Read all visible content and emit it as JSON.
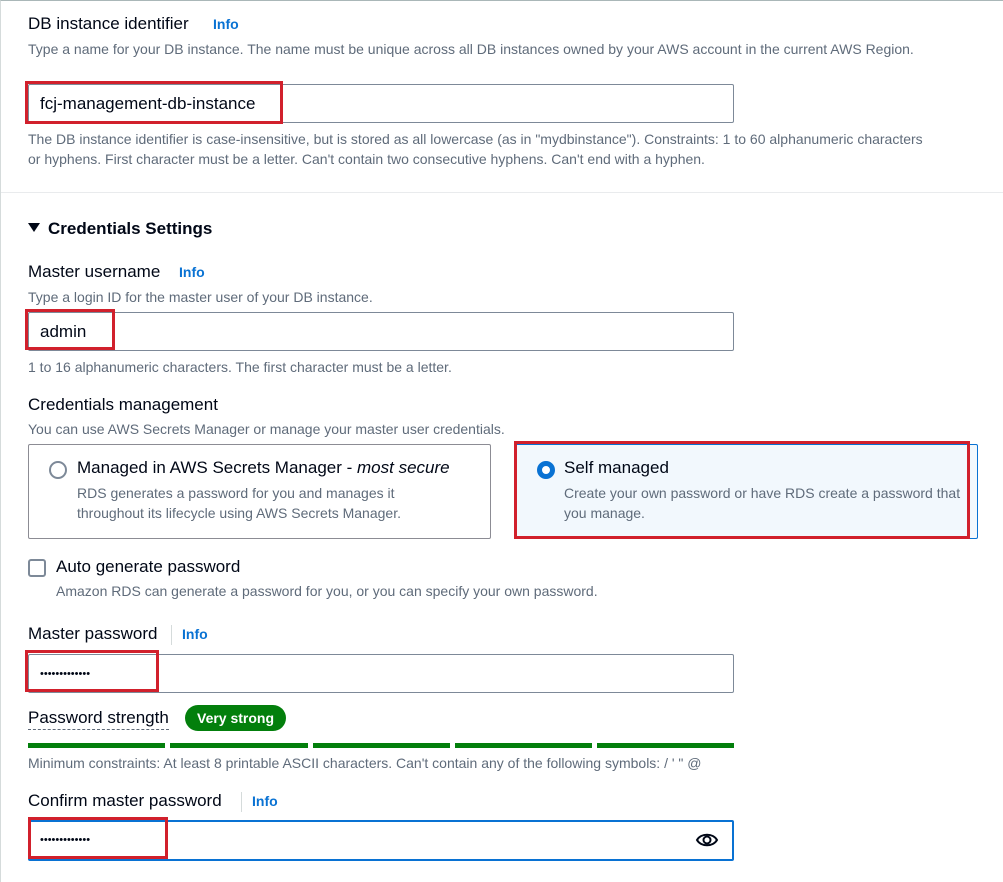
{
  "instance": {
    "label": "DB instance identifier",
    "info": "Info",
    "description": "Type a name for your DB instance. The name must be unique across all DB instances owned by your AWS account in the current AWS Region.",
    "value": "fcj-management-db-instance",
    "hint": "The DB instance identifier is case-insensitive, but is stored as all lowercase (as in \"mydbinstance\"). Constraints: 1 to 60 alphanumeric characters or hyphens. First character must be a letter. Can't contain two consecutive hyphens. Can't end with a hyphen."
  },
  "credentials": {
    "heading": "Credentials Settings",
    "username": {
      "label": "Master username",
      "info": "Info",
      "description": "Type a login ID for the master user of your DB instance.",
      "value": "admin",
      "hint": "1 to 16 alphanumeric characters. The first character must be a letter."
    },
    "management": {
      "label": "Credentials management",
      "description": "You can use AWS Secrets Manager or manage your master user credentials.",
      "options": [
        {
          "title": "Managed in AWS Secrets Manager - ",
          "title_em": "most secure",
          "description": "RDS generates a password for you and manages it throughout its lifecycle using AWS Secrets Manager.",
          "selected": false
        },
        {
          "title": "Self managed",
          "title_em": "",
          "description": "Create your own password or have RDS create a password that you manage.",
          "selected": true
        }
      ]
    },
    "auto_generate": {
      "label": "Auto generate password",
      "description": "Amazon RDS can generate a password for you, or you can specify your own password.",
      "checked": false
    },
    "password": {
      "label": "Master password",
      "info": "Info",
      "value": "•••••••••••••",
      "strength_label": "Password strength",
      "strength_value": "Very strong",
      "strength_fraction": 1.0,
      "constraints": "Minimum constraints: At least 8 printable ASCII characters. Can't contain any of the following symbols: / ' \" @"
    },
    "confirm": {
      "label": "Confirm master password",
      "info": "Info",
      "value": "•••••••••••••"
    }
  },
  "colors": {
    "highlight": "#d1202c",
    "link": "#0972d3",
    "strength": "#037f0c"
  }
}
